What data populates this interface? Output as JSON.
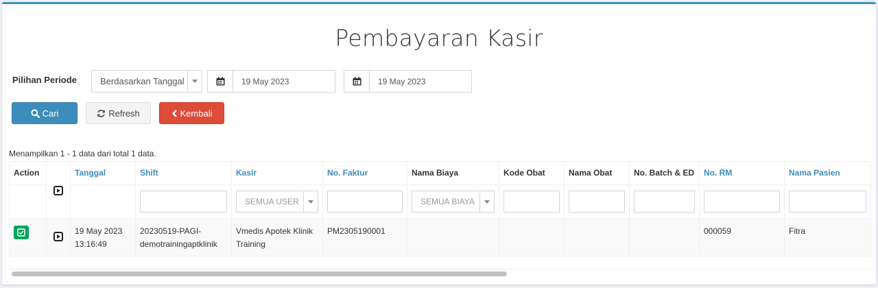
{
  "page": {
    "title": "Pembayaran Kasir"
  },
  "filters": {
    "periode_label": "Pilihan Periode",
    "periode_select": "Berdasarkan Tanggal",
    "date_from": "19 May 2023",
    "date_to": "19 May 2023"
  },
  "buttons": {
    "cari": "Cari",
    "refresh": "Refresh",
    "kembali": "Kembali"
  },
  "summary": "Menampilkan 1 - 1 data dari total 1 data.",
  "table": {
    "headers": {
      "action": "Action",
      "tanggal": "Tanggal",
      "shift": "Shift",
      "kasir": "Kasir",
      "no_faktur": "No. Faktur",
      "nama_biaya": "Nama Biaya",
      "kode_obat": "Kode Obat",
      "nama_obat": "Nama Obat",
      "no_batch": "No. Batch & ED",
      "no_rm": "No. RM",
      "nama_pasien": "Nama Pasien"
    },
    "filter_placeholders": {
      "kasir": "SEMUA USER",
      "nama_biaya": "SEMUA BIAYA"
    },
    "rows": [
      {
        "tanggal_date": "19 May 2023",
        "tanggal_time": "13:16:49",
        "shift_line1": "20230519-PAGI-",
        "shift_line2": "demotrainingaptklinik",
        "kasir_line1": "Vmedis Apotek Klinik",
        "kasir_line2": "Training",
        "no_faktur": "PM2305190001",
        "nama_biaya": "",
        "kode_obat": "",
        "nama_obat": "",
        "no_batch": "",
        "no_rm": "000059",
        "nama_pasien": "Fitra"
      }
    ]
  },
  "colors": {
    "primary": "#3c8dbc",
    "danger": "#dd4b39",
    "success": "#00a65a",
    "header_link": "#3c8dbc"
  },
  "icons": {
    "cari": "search-icon",
    "refresh": "refresh-icon",
    "kembali": "chevron-left-icon",
    "date": "calendar-icon",
    "expand": "play-icon",
    "action": "check-icon"
  }
}
